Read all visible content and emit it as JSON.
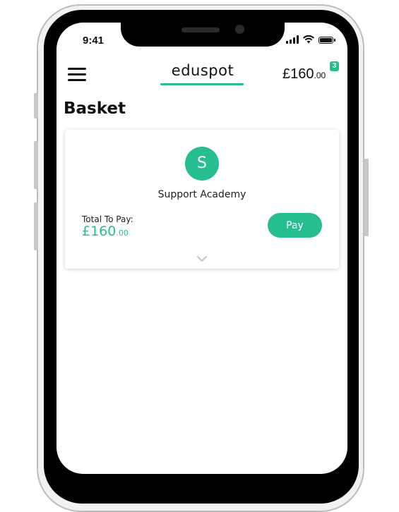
{
  "status_bar": {
    "time": "9:41",
    "icons": [
      "signal-icon",
      "wifi-icon",
      "battery-icon"
    ]
  },
  "header": {
    "menu_icon": "hamburger-menu-icon",
    "logo": "eduspot",
    "balance_pounds": "£160",
    "balance_pence": ".00",
    "badge_count": "3"
  },
  "page": {
    "title": "Basket"
  },
  "basket_card": {
    "avatar_letter": "S",
    "school_name": "Support Academy",
    "total_label": "Total To Pay:",
    "total_pounds": "£160",
    "total_pence": ".00",
    "pay_label": "Pay",
    "expand_icon": "chevron-down-icon"
  },
  "colors": {
    "accent": "#26bd91",
    "text": "#111111",
    "bezel": "#000000"
  }
}
